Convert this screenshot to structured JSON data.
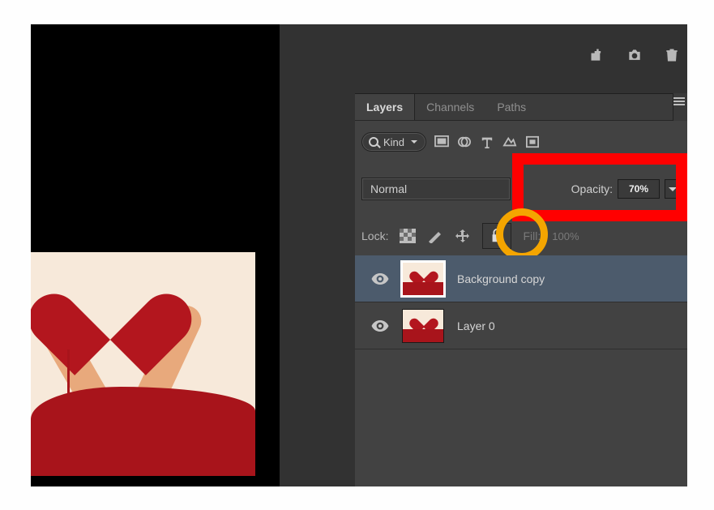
{
  "tabs": {
    "layers": "Layers",
    "channels": "Channels",
    "paths": "Paths"
  },
  "filter": {
    "kind_label": "Kind"
  },
  "blend": {
    "mode": "Normal",
    "opacity_label": "Opacity:",
    "opacity_value": "70%"
  },
  "lock": {
    "label": "Lock:",
    "fill_label": "Fill:",
    "fill_value": "100%"
  },
  "layers": [
    {
      "name": "Background copy",
      "selected": true,
      "visible": true
    },
    {
      "name": "Layer 0",
      "selected": false,
      "visible": true
    }
  ],
  "chart_data": null
}
